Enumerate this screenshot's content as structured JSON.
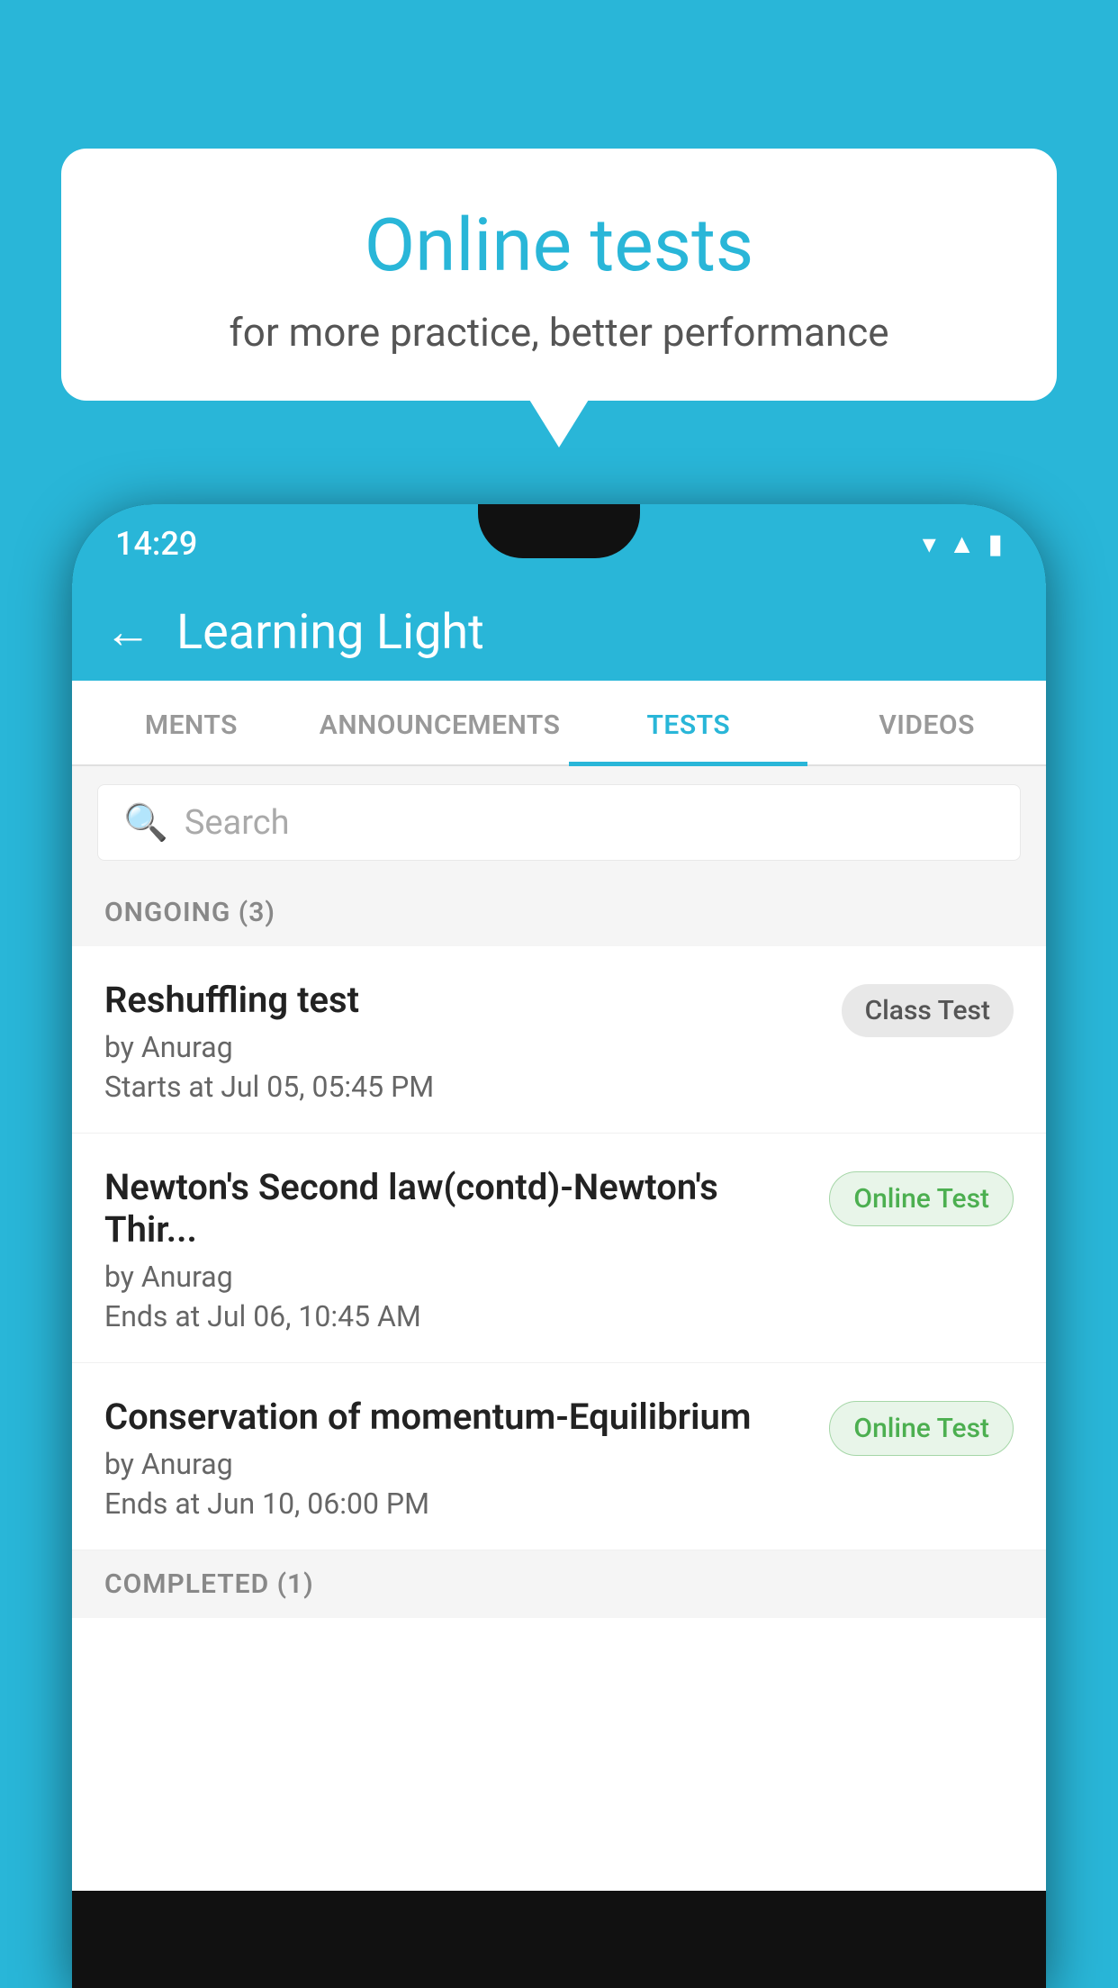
{
  "background_color": "#29b6d8",
  "speech_bubble": {
    "title": "Online tests",
    "subtitle": "for more practice, better performance"
  },
  "phone": {
    "time": "14:29",
    "status_icons": [
      "wifi",
      "signal",
      "battery"
    ]
  },
  "app_header": {
    "title": "Learning Light",
    "back_label": "←"
  },
  "tabs": [
    {
      "label": "MENTS",
      "active": false
    },
    {
      "label": "ANNOUNCEMENTS",
      "active": false
    },
    {
      "label": "TESTS",
      "active": true
    },
    {
      "label": "VIDEOS",
      "active": false
    }
  ],
  "search": {
    "placeholder": "Search"
  },
  "sections": [
    {
      "label": "ONGOING (3)",
      "items": [
        {
          "name": "Reshuffling test",
          "by": "by Anurag",
          "time_label": "Starts at",
          "time": "Jul 05, 05:45 PM",
          "badge": "Class Test",
          "badge_type": "class"
        },
        {
          "name": "Newton's Second law(contd)-Newton's Thir...",
          "by": "by Anurag",
          "time_label": "Ends at",
          "time": "Jul 06, 10:45 AM",
          "badge": "Online Test",
          "badge_type": "online"
        },
        {
          "name": "Conservation of momentum-Equilibrium",
          "by": "by Anurag",
          "time_label": "Ends at",
          "time": "Jun 10, 06:00 PM",
          "badge": "Online Test",
          "badge_type": "online"
        }
      ]
    },
    {
      "label": "COMPLETED (1)",
      "items": []
    }
  ]
}
